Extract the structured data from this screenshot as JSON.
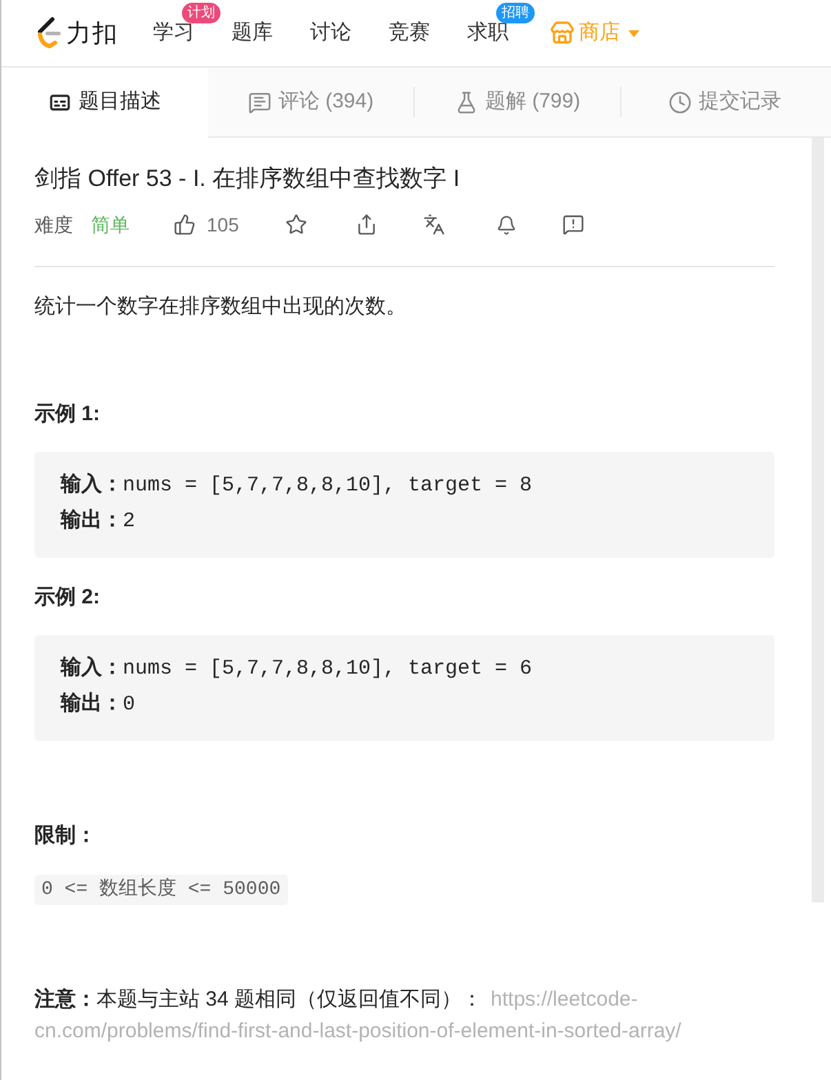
{
  "nav": {
    "logo_text": "力扣",
    "items": [
      {
        "label": "学习",
        "kind": "link",
        "badge": {
          "text": "计划",
          "color": "#ec4a7b"
        }
      },
      {
        "label": "题库",
        "kind": "link"
      },
      {
        "label": "讨论",
        "kind": "link"
      },
      {
        "label": "竞赛",
        "kind": "link"
      },
      {
        "label": "求职",
        "kind": "link",
        "badge": {
          "text": "招聘",
          "color": "#1c98f7"
        }
      },
      {
        "label": "商店",
        "kind": "store"
      }
    ]
  },
  "tabs": [
    {
      "label": "题目描述",
      "selected": true
    },
    {
      "label": "评论 (394)",
      "selected": false
    },
    {
      "label": "题解 (799)",
      "selected": false
    },
    {
      "label": "提交记录",
      "selected": false
    }
  ],
  "problem": {
    "title": "剑指 Offer 53 - I. 在排序数组中查找数字 I",
    "difficulty_label": "难度",
    "difficulty": "简单",
    "likes": "105",
    "description": "统计一个数字在排序数组中出现的次数。",
    "examples": [
      {
        "heading": "示例 1:",
        "lines": [
          "**输入：**nums = [5,7,7,8,8,10], target = 8",
          "**输出：**2"
        ]
      },
      {
        "heading": "示例 2:",
        "lines": [
          "**输入：**nums = [5,7,7,8,8,10], target = 6",
          "**输出：**0"
        ]
      }
    ],
    "constraints": {
      "heading": "限制：",
      "code": "0 <= 数组长度 <= 50000"
    },
    "note": {
      "text": "**注意：**本题与主站 34 题相同（仅返回值不同）：",
      "link": "https://leetcode-cn.com/problems/find-first-and-last-position-of-element-in-sorted-array/"
    }
  }
}
